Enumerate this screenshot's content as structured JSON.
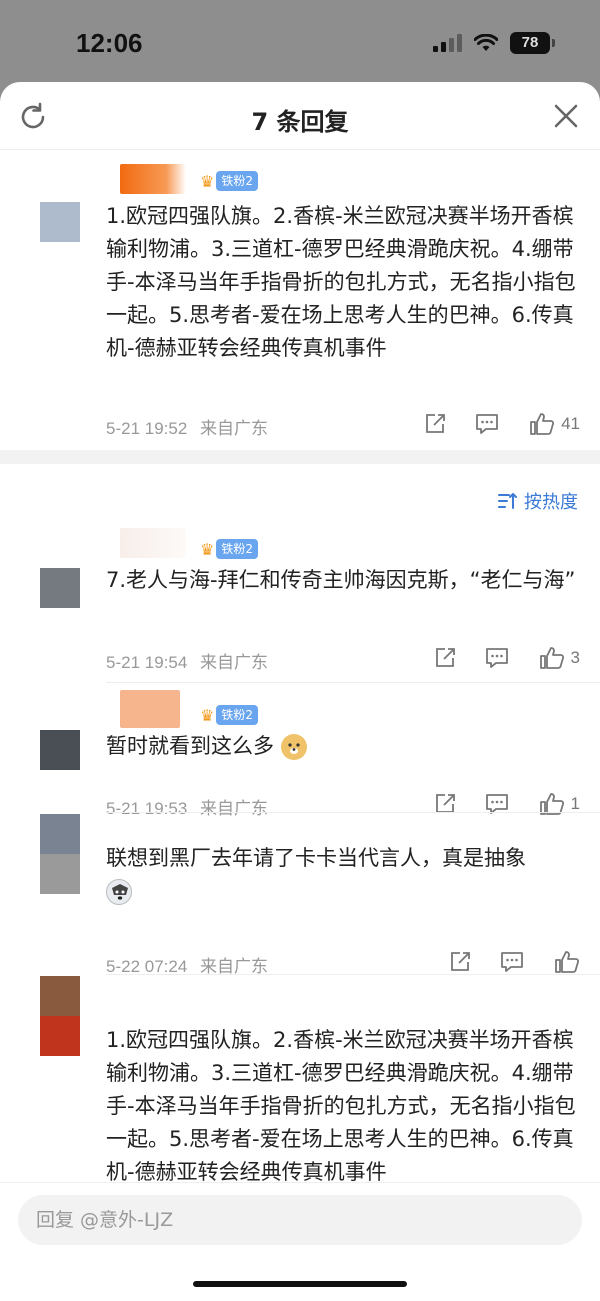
{
  "status": {
    "time": "12:06",
    "battery": "78"
  },
  "header": {
    "title": "7 条回复"
  },
  "sort": {
    "label": "按热度"
  },
  "comments": [
    {
      "badge": "铁粉2",
      "text": "1.欧冠四强队旗。2.香槟-米兰欧冠决赛半场开香槟输利物浦。3.三道杠-德罗巴经典滑跪庆祝。4.绷带手-本泽马当年手指骨折的包扎方式，无名指小指包一起。5.思考者-爱在场上思考人生的巴神。6.传真机-德赫亚转会经典传真机事件",
      "time": "5-21 19:52",
      "location": "来自广东",
      "likes": "41"
    },
    {
      "badge": "铁粉2",
      "text": "7.老人与海-拜仁和传奇主帅海因克斯，“老仁与海”",
      "time": "5-21 19:54",
      "location": "来自广东",
      "likes": "3"
    },
    {
      "badge": "铁粉2",
      "text": "暂时就看到这么多",
      "time": "5-21 19:53",
      "location": "来自广东",
      "likes": "1"
    },
    {
      "text": "联想到黑厂去年请了卡卡当代言人，真是抽象",
      "time": "5-22 07:24",
      "location": "来自广东",
      "likes": ""
    },
    {
      "text": "1.欧冠四强队旗。2.香槟-米兰欧冠决赛半场开香槟输利物浦。3.三道杠-德罗巴经典滑跪庆祝。4.绷带手-本泽马当年手指骨折的包扎方式，无名指小指包一起。5.思考者-爱在场上思考人生的巴神。6.传真机-德赫亚转会经典传真机事件"
    }
  ],
  "reply": {
    "placeholder": "回复 @意外-LJZ"
  },
  "icons": [
    "refresh-icon",
    "close-icon",
    "sort-icon",
    "share-icon",
    "comment-icon",
    "like-icon",
    "crown-icon",
    "doge-emoji",
    "husky-emoji"
  ],
  "colors": {
    "accent": "#3b7ad6",
    "badge": "#6aa6f0",
    "crown": "#f29a1e"
  }
}
